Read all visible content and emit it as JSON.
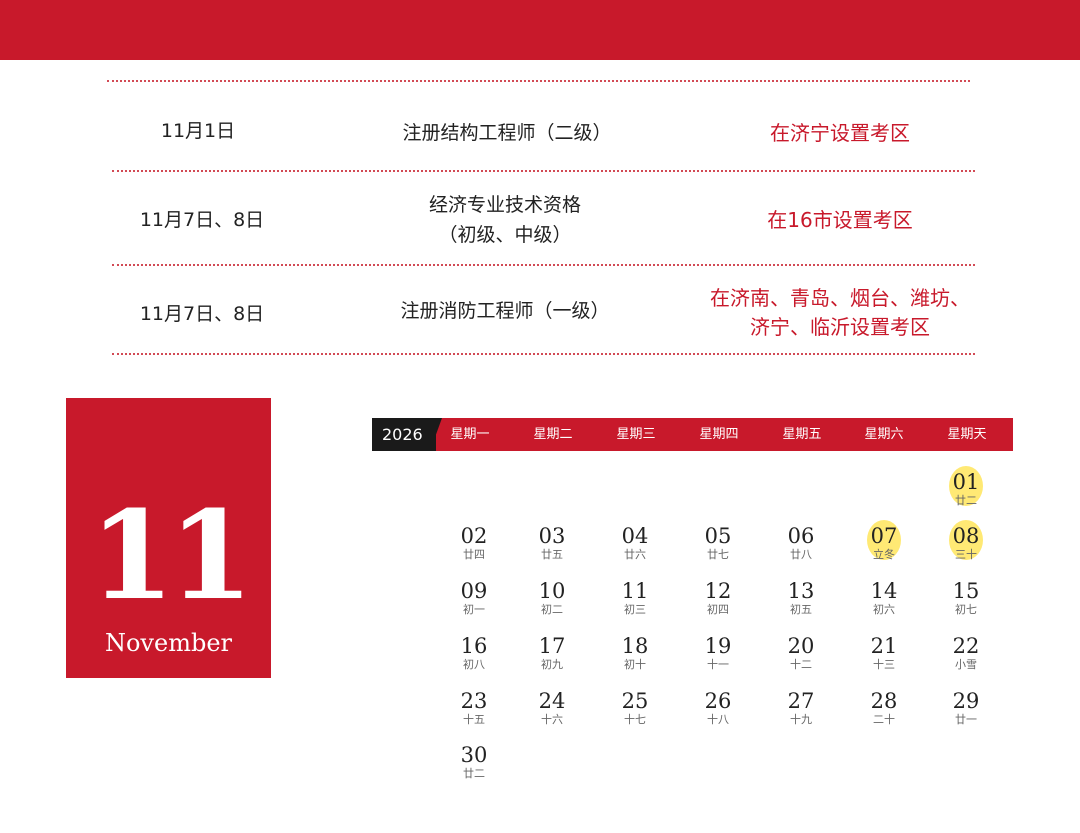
{
  "exam_rows": [
    {
      "date": "11月1日",
      "exam_lines": [
        "注册结构工程师（二级）"
      ],
      "location_lines": [
        "在济宁设置考区"
      ]
    },
    {
      "date": "11月7日、8日",
      "exam_lines": [
        "经济专业技术资格",
        "（初级、中级）"
      ],
      "location_lines": [
        "在16市设置考区"
      ]
    },
    {
      "date": "11月7日、8日",
      "exam_lines": [
        "注册消防工程师（一级）"
      ],
      "location_lines": [
        "在济南、青岛、烟台、潍坊、",
        "济宁、临沂设置考区"
      ]
    }
  ],
  "month_block": {
    "number": "11",
    "name": "November"
  },
  "calendar": {
    "year": "2026",
    "weekdays": [
      "星期一",
      "星期二",
      "星期三",
      "星期四",
      "星期五",
      "星期六",
      "星期天"
    ],
    "highlight_color": "#ffe55c",
    "weeks": [
      [
        null,
        null,
        null,
        null,
        null,
        null,
        {
          "d": "01",
          "l": "廿二",
          "hl": true
        }
      ],
      [
        {
          "d": "02",
          "l": "廿四"
        },
        {
          "d": "03",
          "l": "廿五"
        },
        {
          "d": "04",
          "l": "廿六"
        },
        {
          "d": "05",
          "l": "廿七"
        },
        {
          "d": "06",
          "l": "廿八"
        },
        {
          "d": "07",
          "l": "立冬",
          "hl": true
        },
        {
          "d": "08",
          "l": "三十",
          "hl": true
        }
      ],
      [
        {
          "d": "09",
          "l": "初一"
        },
        {
          "d": "10",
          "l": "初二"
        },
        {
          "d": "11",
          "l": "初三"
        },
        {
          "d": "12",
          "l": "初四"
        },
        {
          "d": "13",
          "l": "初五"
        },
        {
          "d": "14",
          "l": "初六"
        },
        {
          "d": "15",
          "l": "初七"
        }
      ],
      [
        {
          "d": "16",
          "l": "初八"
        },
        {
          "d": "17",
          "l": "初九"
        },
        {
          "d": "18",
          "l": "初十"
        },
        {
          "d": "19",
          "l": "十一"
        },
        {
          "d": "20",
          "l": "十二"
        },
        {
          "d": "21",
          "l": "十三"
        },
        {
          "d": "22",
          "l": "小雪"
        }
      ],
      [
        {
          "d": "23",
          "l": "十五"
        },
        {
          "d": "24",
          "l": "十六"
        },
        {
          "d": "25",
          "l": "十七"
        },
        {
          "d": "26",
          "l": "十八"
        },
        {
          "d": "27",
          "l": "十九"
        },
        {
          "d": "28",
          "l": "二十"
        },
        {
          "d": "29",
          "l": "廿一"
        }
      ],
      [
        {
          "d": "30",
          "l": "廿二"
        },
        null,
        null,
        null,
        null,
        null,
        null
      ]
    ]
  },
  "colors": {
    "brand_red": "#c8192b",
    "year_tab": "#1a1a1a"
  }
}
